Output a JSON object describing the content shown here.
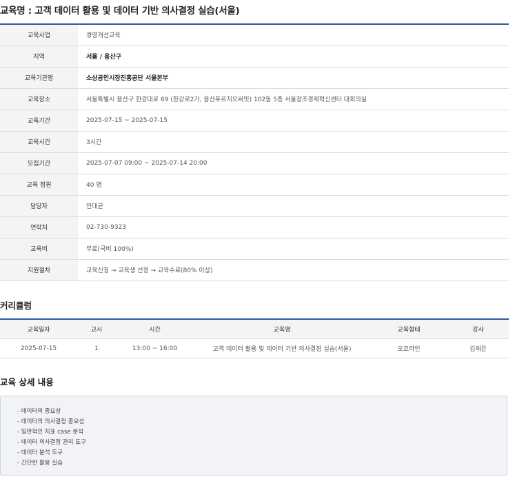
{
  "page": {
    "title": "교육명 : 고객 데이터 활용 및 데이터 기반 의사결정 실습(서울)"
  },
  "info": [
    {
      "label": "교육사업",
      "value": "경영개선교육",
      "strong": false
    },
    {
      "label": "지역",
      "value": "서울 / 용산구",
      "strong": true
    },
    {
      "label": "교육기관명",
      "value": "소상공인시장진흥공단 서울본부",
      "strong": true
    },
    {
      "label": "교육장소",
      "value": "서울특별시 용산구 한강대로 69 (한강로2가, 용산푸르지오써밋) 102동 5층 서울창조경제혁신센터 대회의실",
      "strong": false
    },
    {
      "label": "교육기간",
      "value": "2025-07-15 ~ 2025-07-15",
      "strong": false
    },
    {
      "label": "교육시간",
      "value": "3시간",
      "strong": false
    },
    {
      "label": "모집기간",
      "value": "2025-07-07 09:00 ~ 2025-07-14 20:00",
      "strong": false
    },
    {
      "label": "교육 정원",
      "value": "40 명",
      "strong": false
    },
    {
      "label": "담당자",
      "value": "안대균",
      "strong": false
    },
    {
      "label": "연락처",
      "value": "02-730-9323",
      "strong": false
    },
    {
      "label": "교육비",
      "value": "무료(국비 100%)",
      "strong": false
    },
    {
      "label": "지원절차",
      "value": "교육신청 → 교육생 선정 → 교육수료(80% 이상)",
      "strong": false
    }
  ],
  "curriculum": {
    "heading": "커리큘럼",
    "columns": [
      "교육일자",
      "교시",
      "시간",
      "교육명",
      "교육형태",
      "강사"
    ],
    "rows": [
      [
        "2025-07-15",
        "1",
        "13:00 ~ 16:00",
        "고객 데이터 활용 및 데이터 기반 의사결정 실습(서울)",
        "오프라인",
        "김재은"
      ]
    ]
  },
  "detail": {
    "heading": "교육 상세 내용",
    "items": [
      "데이터의 중요성",
      "데이터의 의사결정 중요성",
      "일반적인 지표 case 분석",
      "데이터 의사결정 관리 도구",
      "데이터 분석 도구",
      "간단한 활용 실습"
    ]
  }
}
